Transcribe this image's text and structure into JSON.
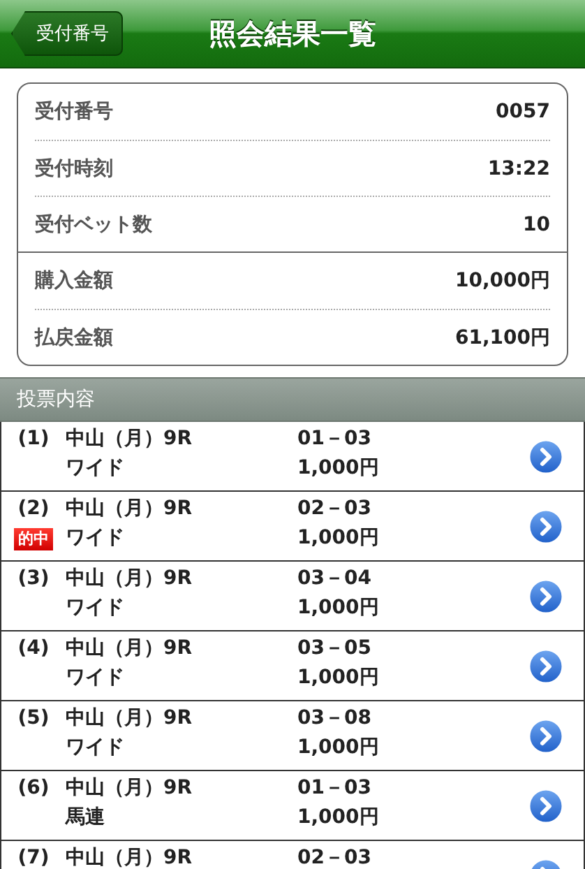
{
  "header": {
    "back_button": "受付番号",
    "title": "照会結果一覧"
  },
  "summary": {
    "groups": [
      {
        "rows": [
          {
            "label": "受付番号",
            "value": "0057"
          },
          {
            "label": "受付時刻",
            "value": "13:22"
          },
          {
            "label": "受付ベット数",
            "value": "10"
          }
        ]
      },
      {
        "rows": [
          {
            "label": "購入金額",
            "value": "10,000円"
          },
          {
            "label": "払戻金額",
            "value": "61,100円"
          }
        ]
      }
    ]
  },
  "section": {
    "title": "投票内容"
  },
  "bets": [
    {
      "number": "(1)",
      "race": "中山（月）9R",
      "type": "ワイド",
      "combination": "01－03",
      "amount": "1,000円",
      "hit": false
    },
    {
      "number": "(2)",
      "race": "中山（月）9R",
      "type": "ワイド",
      "combination": "02－03",
      "amount": "1,000円",
      "hit": true,
      "hit_label": "的中"
    },
    {
      "number": "(3)",
      "race": "中山（月）9R",
      "type": "ワイド",
      "combination": "03－04",
      "amount": "1,000円",
      "hit": false
    },
    {
      "number": "(4)",
      "race": "中山（月）9R",
      "type": "ワイド",
      "combination": "03－05",
      "amount": "1,000円",
      "hit": false
    },
    {
      "number": "(5)",
      "race": "中山（月）9R",
      "type": "ワイド",
      "combination": "03－08",
      "amount": "1,000円",
      "hit": false
    },
    {
      "number": "(6)",
      "race": "中山（月）9R",
      "type": "馬連",
      "combination": "01－03",
      "amount": "1,000円",
      "hit": false
    },
    {
      "number": "(7)",
      "race": "中山（月）9R",
      "combination": "02－03",
      "hit": false
    }
  ]
}
